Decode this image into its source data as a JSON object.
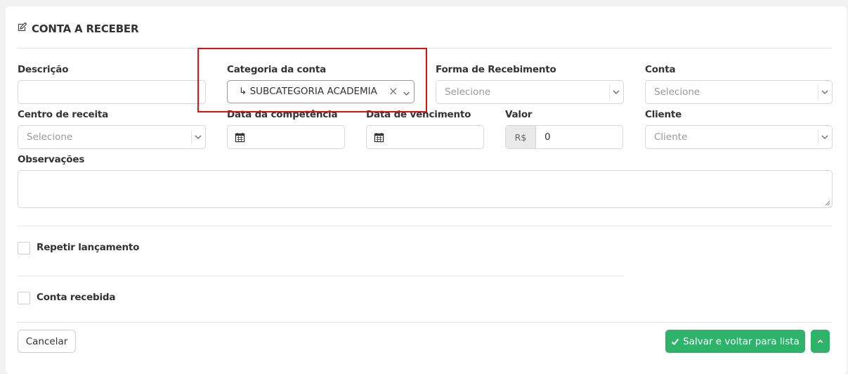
{
  "header": {
    "title": "CONTA A RECEBER",
    "icon": "edit-icon"
  },
  "fields": {
    "descricao": {
      "label": "Descrição",
      "value": ""
    },
    "categoria": {
      "label": "Categoria da conta",
      "value": "↳ SUBCATEGORIA ACADEMIA",
      "clear": "×"
    },
    "forma": {
      "label": "Forma de Recebimento",
      "placeholder": "Selecione"
    },
    "conta": {
      "label": "Conta",
      "placeholder": "Selecione"
    },
    "centro": {
      "label": "Centro de receita",
      "placeholder": "Selecione"
    },
    "competencia": {
      "label": "Data da competência",
      "value": ""
    },
    "vencimento": {
      "label": "Data de vencimento",
      "value": ""
    },
    "valor": {
      "label": "Valor",
      "prefix": "R$",
      "value": "0"
    },
    "cliente": {
      "label": "Cliente",
      "placeholder": "Cliente"
    },
    "observacoes": {
      "label": "Observações",
      "value": ""
    }
  },
  "checks": {
    "repetir": {
      "label": "Repetir lançamento",
      "checked": false
    },
    "recebida": {
      "label": "Conta recebida",
      "checked": false
    }
  },
  "buttons": {
    "cancel": "Cancelar",
    "save": "Salvar e voltar para lista"
  },
  "colors": {
    "primary_green": "#2fb36b",
    "highlight_red": "#e01010"
  }
}
